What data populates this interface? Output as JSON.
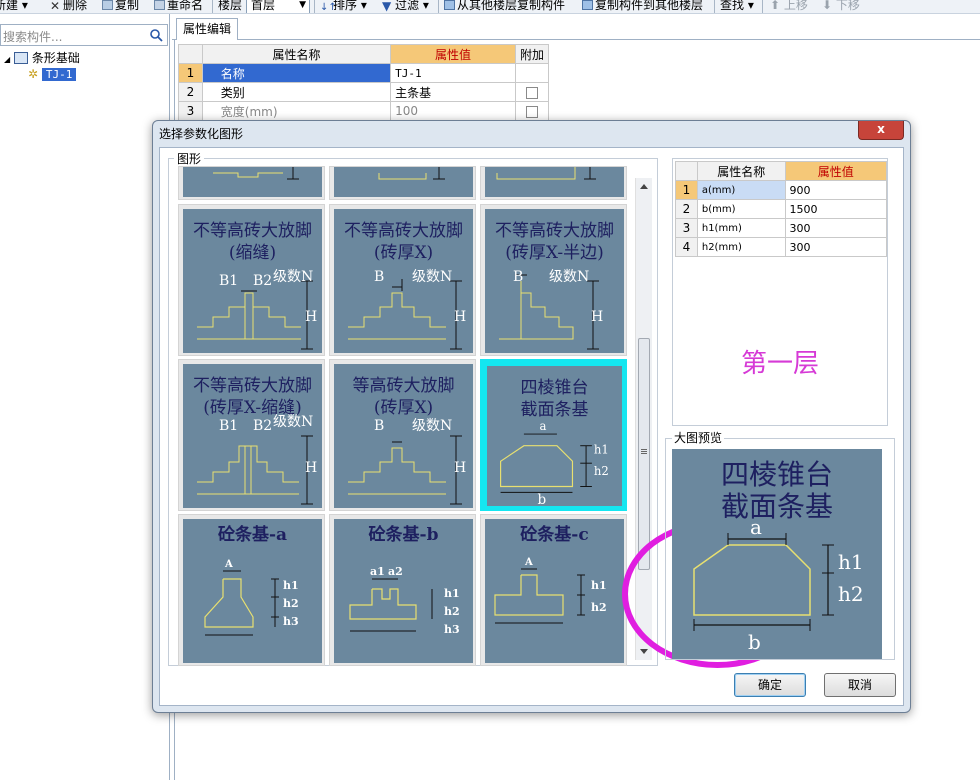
{
  "toolbar": {
    "new": "新建",
    "delete": "删除",
    "copy": "复制",
    "rename": "重命名",
    "floor_label": "楼层",
    "floor_value": "首层",
    "sort": "排序",
    "filter": "过滤",
    "copy_from_other": "从其他楼层复制构件",
    "copy_to_other": "复制构件到其他楼层",
    "find": "查找",
    "move_up": "上移",
    "move_down": "下移"
  },
  "left": {
    "search_placeholder": "搜索构件...",
    "tree_root": "条形基础",
    "tree_child": "TJ-1"
  },
  "prop_editor": {
    "tab": "属性编辑",
    "headers": [
      "属性名称",
      "属性值",
      "附加"
    ],
    "rows": [
      {
        "num": "1",
        "name": "名称",
        "value": "TJ-1"
      },
      {
        "num": "2",
        "name": "类别",
        "value": "主条基"
      },
      {
        "num": "3",
        "name": "宽度(mm)",
        "value": "100"
      }
    ]
  },
  "dialog": {
    "title": "选择参数化图形",
    "close": "x",
    "group_label": "图形",
    "shapes": [
      {
        "line1": "不等高砖大放脚",
        "line2": "(缩缝)",
        "labels": [
          "B1",
          "B2",
          "级数N",
          "H"
        ]
      },
      {
        "line1": "不等高砖大放脚",
        "line2": "(砖厚X)",
        "labels": [
          "B",
          "级数N",
          "H"
        ]
      },
      {
        "line1": "不等高砖大放脚",
        "line2": "(砖厚X-半边)",
        "labels": [
          "B",
          "级数N",
          "H"
        ]
      },
      {
        "line1": "不等高砖大放脚",
        "line2": "(砖厚X-缩缝)",
        "labels": [
          "B1",
          "B2",
          "级数N",
          "H"
        ]
      },
      {
        "line1": "等高砖大放脚",
        "line2": "(砖厚X)",
        "labels": [
          "B",
          "级数N",
          "H"
        ]
      },
      {
        "line1": "四棱锥台",
        "line2": "截面条基",
        "labels": [
          "a",
          "h1",
          "h2",
          "b"
        ]
      },
      {
        "line1": "砼条基-a",
        "labels": [
          "A",
          "h1",
          "h2",
          "h3"
        ]
      },
      {
        "line1": "砼条基-b",
        "labels": [
          "a1",
          "a2",
          "h1",
          "h2",
          "h3"
        ]
      },
      {
        "line1": "砼条基-c",
        "labels": [
          "A",
          "h1",
          "h2"
        ]
      }
    ],
    "attr_headers": [
      "属性名称",
      "属性值"
    ],
    "attr_rows": [
      {
        "num": "1",
        "name": "a(mm)",
        "value": "900"
      },
      {
        "num": "2",
        "name": "b(mm)",
        "value": "1500"
      },
      {
        "num": "3",
        "name": "h1(mm)",
        "value": "300"
      },
      {
        "num": "4",
        "name": "h2(mm)",
        "value": "300"
      }
    ],
    "floor_text": "第一层",
    "preview_label": "大图预览",
    "preview": {
      "line1": "四棱锥台",
      "line2": "截面条基",
      "labels": [
        "a",
        "h1",
        "h2",
        "b"
      ]
    },
    "ok": "确定",
    "cancel": "取消"
  },
  "colors": {
    "tile_bg": "#6b889e",
    "selected_border": "#14e6f0",
    "highlight_circle": "#e01ee0",
    "floor_text": "#d63ad6",
    "header_highlight": "#f5c878"
  }
}
